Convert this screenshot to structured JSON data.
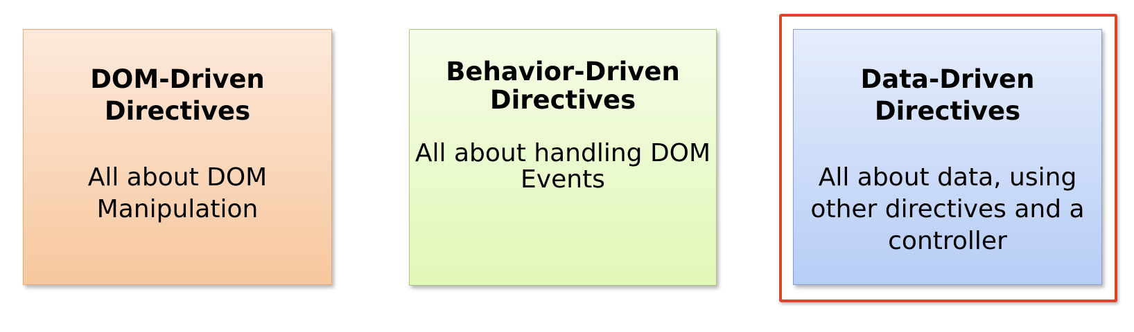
{
  "boxes": [
    {
      "title_line1": "DOM-Driven",
      "title_line2": "Directives",
      "desc_line1": "All about DOM",
      "desc_line2": "Manipulation",
      "color": "#f7c79d"
    },
    {
      "title_line1": "Behavior-Driven",
      "title_line2": "Directives",
      "desc_line1": "All about handling DOM",
      "desc_line2": "Events",
      "color": "#e2f7b7"
    },
    {
      "title_line1": "Data-Driven",
      "title_line2": "Directives",
      "desc_line1": "All about data, using",
      "desc_line2": "other directives and a",
      "desc_line3": "controller",
      "color": "#b7cdf6",
      "highlighted": true
    }
  ],
  "highlight_color": "#e0432c"
}
